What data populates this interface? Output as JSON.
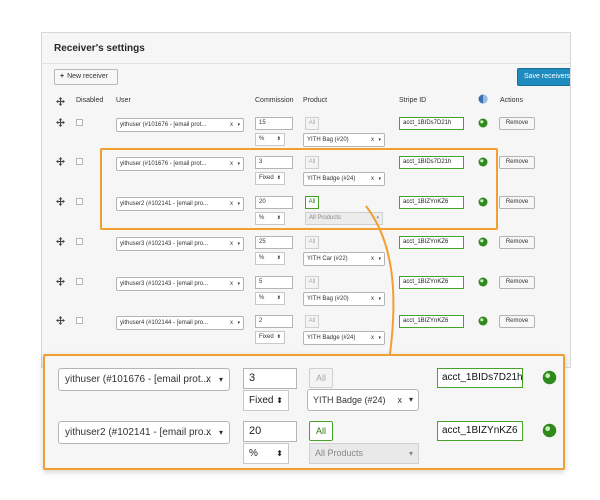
{
  "panel": {
    "title": "Receiver's settings",
    "new_receiver_label": "New receiver",
    "save_label": "Save receivers"
  },
  "columns": {
    "disabled": "Disabled",
    "user": "User",
    "commission": "Commission",
    "product": "Product",
    "stripe_id": "Stripe ID",
    "actions": "Actions"
  },
  "rows": [
    {
      "user": "yithuser (#101676 - [email prot...",
      "commission": "15",
      "unit": "%",
      "all": "All",
      "all_active": false,
      "product": "YITH Bag (#20)",
      "stripe": "acct_1BIDs7D21h",
      "action": "Remove"
    },
    {
      "user": "yithuser (#101676 - [email prot...",
      "commission": "3",
      "unit": "Fixed",
      "all": "All",
      "all_active": false,
      "product": "YITH Badge (#24)",
      "stripe": "acct_1BIDs7D21h",
      "action": "Remove"
    },
    {
      "user": "yithuser2 (#102141 - [email pro...",
      "commission": "20",
      "unit": "%",
      "all": "All",
      "all_active": true,
      "product": "All Products",
      "stripe": "acct_1BIZYnKZ6",
      "action": "Remove"
    },
    {
      "user": "yithuser3 (#102143 - [email pro...",
      "commission": "25",
      "unit": "%",
      "all": "All",
      "all_active": false,
      "product": "YITH Car (#22)",
      "stripe": "acct_1BIZYnKZ6",
      "action": "Remove"
    },
    {
      "user": "yithuser3 (#102143 - [email pro...",
      "commission": "5",
      "unit": "%",
      "all": "All",
      "all_active": false,
      "product": "YITH Bag (#20)",
      "stripe": "acct_1BIZYnKZ6",
      "action": "Remove"
    },
    {
      "user": "yithuser4 (#102144 - [email pro...",
      "commission": "2",
      "unit": "Fixed",
      "all": "All",
      "all_active": false,
      "product": "YITH Badge (#24)",
      "stripe": "acct_1BIZYnKZ6",
      "action": "Remove"
    }
  ],
  "zoom": [
    {
      "user": "yithuser (#101676 - [email prot...",
      "commission": "3",
      "unit": "Fixed",
      "all": "All",
      "all_active": false,
      "product": "YITH Badge (#24)",
      "stripe": "acct_1BIDs7D21h"
    },
    {
      "user": "yithuser2 (#102141 - [email pro...",
      "commission": "20",
      "unit": "%",
      "all": "All",
      "all_active": true,
      "product": "All Products",
      "stripe": "acct_1BIZYnKZ6"
    }
  ],
  "colors": {
    "accent": "#1e8cbe",
    "highlight": "#f0a030",
    "valid": "#46a32a"
  },
  "icons": {
    "move": "move-arrows-icon",
    "globe": "globe-icon",
    "remove_value": "x",
    "dropdown": "▾",
    "spinner": "⬍"
  }
}
